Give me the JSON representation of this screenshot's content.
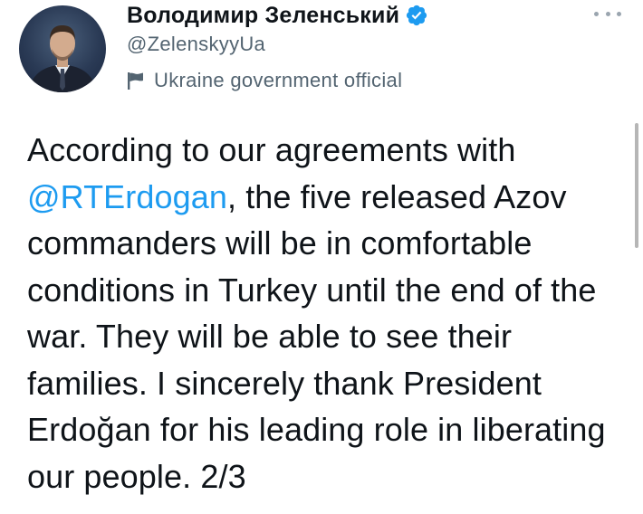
{
  "profile": {
    "display_name": "Володимир Зеленський",
    "handle": "@ZelenskyyUa",
    "label": "Ukraine government official",
    "verified_icon": "verified-badge-icon",
    "label_icon": "flag-icon"
  },
  "tweet": {
    "text_before_mention": "According to our agreements with ",
    "mention": "@RTErdogan",
    "text_after_mention": ", the five released Azov commanders will be in comfortable conditions in Turkey until the end of the war. They will be able to see their families. I sincerely thank President Erdoğan for his leading role in liberating our people. 2/3"
  },
  "colors": {
    "link": "#1d9bf0",
    "verified": "#1d9bf0",
    "secondary_text": "#536471",
    "primary_text": "#0f1419"
  }
}
